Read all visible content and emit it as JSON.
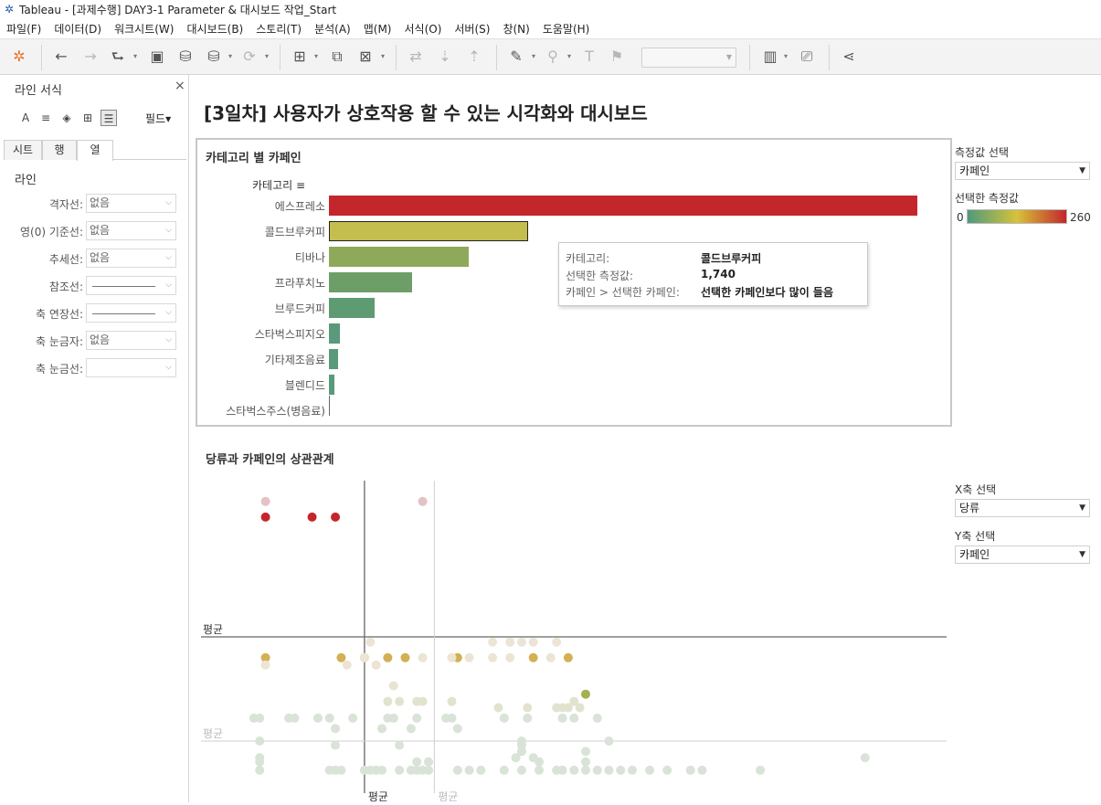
{
  "window": {
    "title": "Tableau - [과제수행] DAY3-1 Parameter & 대시보드 작업_Start"
  },
  "menu": [
    "파일(F)",
    "데이터(D)",
    "워크시트(W)",
    "대시보드(B)",
    "스토리(T)",
    "분석(A)",
    "맵(M)",
    "서식(O)",
    "서버(S)",
    "창(N)",
    "도움말(H)"
  ],
  "toolbar": {
    "buttons": [
      "tableau-logo-icon",
      "undo-icon",
      "redo-icon",
      "replay-icon",
      "save-icon",
      "add-datasource-icon",
      "pause-update-icon",
      "refresh-icon",
      "new-sheet-icon",
      "duplicate-sheet-icon",
      "clear-sheet-icon",
      "swap-icon",
      "sort-asc-icon",
      "sort-desc-icon",
      "highlight-icon",
      "group-icon",
      "label-icon",
      "pin-icon",
      "showme-icon",
      "presentation-icon",
      "share-icon"
    ],
    "fit_value": ""
  },
  "format_pane": {
    "title": "라인 서식",
    "field_dropdown": "필드",
    "tabs": [
      "시트",
      "행",
      "열"
    ],
    "active_tab": "열",
    "section": "라인",
    "rows": [
      {
        "label": "격자선:",
        "value": "없음",
        "kind": "text"
      },
      {
        "label": "영(0) 기준선:",
        "value": "없음",
        "kind": "text"
      },
      {
        "label": "추세선:",
        "value": "없음",
        "kind": "text"
      },
      {
        "label": "참조선:",
        "value": "",
        "kind": "line"
      },
      {
        "label": "축 연장선:",
        "value": "",
        "kind": "line"
      },
      {
        "label": "축 눈금자:",
        "value": "없음",
        "kind": "text"
      },
      {
        "label": "축 눈금선:",
        "value": "",
        "kind": "empty"
      }
    ]
  },
  "dashboard": {
    "title": "[3일차] 사용자가 상호작용 할 수 있는 시각화와 대시보드",
    "bar_sheet": {
      "title": "카테고리 별 카페인",
      "category_header": "카테고리"
    },
    "tooltip": {
      "rows": [
        {
          "key": "카테고리:",
          "value": "콜드브루커피"
        },
        {
          "key": "선택한 측정값:",
          "value": "1,740"
        },
        {
          "key": "카페인 > 선택한 카페인:",
          "value": "선택한 카페인보다 많이 들음"
        }
      ]
    },
    "scatter_sheet": {
      "title": "당류과 카페인의 상관관계",
      "avg_label": "평균"
    }
  },
  "controls": {
    "measure_select": {
      "title": "측정값 선택",
      "value": "카페인"
    },
    "color_legend": {
      "title": "선택한 측정값",
      "min": "0",
      "max": "260",
      "colors": [
        "#4f9a7c",
        "#d6c23a",
        "#c3272b"
      ]
    },
    "x_select": {
      "title": "X축 선택",
      "value": "당류"
    },
    "y_select": {
      "title": "Y축 선택",
      "value": "카페인"
    }
  },
  "chart_data": [
    {
      "type": "bar",
      "title": "카테고리 별 카페인",
      "categories": [
        "에스프레소",
        "콜드브루커피",
        "티바나",
        "프라푸치노",
        "브루드커피",
        "스타벅스피지오",
        "기타제조음료",
        "블렌디드",
        "스타벅스주스(병음료)"
      ],
      "values": [
        5150,
        1740,
        1220,
        730,
        400,
        95,
        80,
        50,
        0
      ],
      "colors": [
        "#c3272b",
        "#c4be4f",
        "#8fa95a",
        "#6e9e68",
        "#5f9b72",
        "#5a997a",
        "#5a997a",
        "#5a997a",
        "#5a997a"
      ],
      "selected": "콜드브루커피"
    },
    {
      "type": "scatter",
      "title": "당류과 카페인의 상관관계",
      "xlabel": "당류",
      "ylabel": "카페인",
      "xlim": [
        0,
        62
      ],
      "ylim": [
        0,
        300
      ],
      "averages": [
        {
          "x": 12,
          "y": 150,
          "label": "평균",
          "active": true
        },
        {
          "x": 18,
          "y": 50,
          "label": "평균",
          "active": false
        }
      ],
      "points": [
        {
          "x": 3.5,
          "y": 280,
          "c": "#e5c2c4"
        },
        {
          "x": 17,
          "y": 280,
          "c": "#e5c2c4"
        },
        {
          "x": 3.5,
          "y": 265,
          "c": "#c3272b"
        },
        {
          "x": 7.5,
          "y": 265,
          "c": "#c3272b"
        },
        {
          "x": 9.5,
          "y": 265,
          "c": "#c3272b"
        },
        {
          "x": 12.5,
          "y": 145,
          "c": "#ece4d4"
        },
        {
          "x": 23,
          "y": 145,
          "c": "#ece4d4"
        },
        {
          "x": 24.5,
          "y": 145,
          "c": "#ece4d4"
        },
        {
          "x": 25.5,
          "y": 145,
          "c": "#ece4d4"
        },
        {
          "x": 26.5,
          "y": 145,
          "c": "#ece4d4"
        },
        {
          "x": 28.5,
          "y": 145,
          "c": "#ece4d4"
        },
        {
          "x": 3.5,
          "y": 130,
          "c": "#d3b055"
        },
        {
          "x": 10,
          "y": 130,
          "c": "#d3b055"
        },
        {
          "x": 12,
          "y": 130,
          "c": "#d3b055"
        },
        {
          "x": 14,
          "y": 130,
          "c": "#d3b055"
        },
        {
          "x": 15.5,
          "y": 130,
          "c": "#d3b055"
        },
        {
          "x": 20,
          "y": 130,
          "c": "#d3b055"
        },
        {
          "x": 26.5,
          "y": 130,
          "c": "#d3b055"
        },
        {
          "x": 29.5,
          "y": 130,
          "c": "#d3b055"
        },
        {
          "x": 12,
          "y": 130,
          "c": "#ece4d4"
        },
        {
          "x": 17,
          "y": 130,
          "c": "#ece4d4"
        },
        {
          "x": 19.5,
          "y": 130,
          "c": "#ece4d4"
        },
        {
          "x": 21,
          "y": 130,
          "c": "#ece4d4"
        },
        {
          "x": 23,
          "y": 130,
          "c": "#ece4d4"
        },
        {
          "x": 24.5,
          "y": 130,
          "c": "#ece4d4"
        },
        {
          "x": 28,
          "y": 130,
          "c": "#ece4d4"
        },
        {
          "x": 3.5,
          "y": 123,
          "c": "#ece4d4"
        },
        {
          "x": 10.5,
          "y": 123,
          "c": "#ece4d4"
        },
        {
          "x": 13,
          "y": 123,
          "c": "#ece4d4"
        },
        {
          "x": 14.5,
          "y": 103,
          "c": "#e7e5cf"
        },
        {
          "x": 31,
          "y": 95,
          "c": "#a7b050"
        },
        {
          "x": 14,
          "y": 88,
          "c": "#e2e3cf"
        },
        {
          "x": 15,
          "y": 88,
          "c": "#e2e3cf"
        },
        {
          "x": 16.5,
          "y": 88,
          "c": "#e2e3cf"
        },
        {
          "x": 17,
          "y": 88,
          "c": "#e2e3cf"
        },
        {
          "x": 19.5,
          "y": 88,
          "c": "#e2e3cf"
        },
        {
          "x": 30,
          "y": 88,
          "c": "#e2e3cf"
        },
        {
          "x": 29,
          "y": 82,
          "c": "#e2e3cf"
        },
        {
          "x": 23.5,
          "y": 82,
          "c": "#e2e3cf"
        },
        {
          "x": 26,
          "y": 82,
          "c": "#e2e3cf"
        },
        {
          "x": 28.5,
          "y": 82,
          "c": "#e2e3cf"
        },
        {
          "x": 29.5,
          "y": 82,
          "c": "#e2e3cf"
        },
        {
          "x": 30.5,
          "y": 82,
          "c": "#e2e3cf"
        },
        {
          "x": 2.5,
          "y": 72,
          "c": "#d9e3d7"
        },
        {
          "x": 3,
          "y": 72,
          "c": "#d9e3d7"
        },
        {
          "x": 5.5,
          "y": 72,
          "c": "#d9e3d7"
        },
        {
          "x": 6,
          "y": 72,
          "c": "#d9e3d7"
        },
        {
          "x": 8,
          "y": 72,
          "c": "#d9e3d7"
        },
        {
          "x": 9,
          "y": 72,
          "c": "#d9e3d7"
        },
        {
          "x": 11,
          "y": 72,
          "c": "#d9e3d7"
        },
        {
          "x": 14,
          "y": 72,
          "c": "#d9e3d7"
        },
        {
          "x": 14.5,
          "y": 72,
          "c": "#d9e3d7"
        },
        {
          "x": 16.5,
          "y": 72,
          "c": "#d9e3d7"
        },
        {
          "x": 19,
          "y": 72,
          "c": "#d9e3d7"
        },
        {
          "x": 19.5,
          "y": 72,
          "c": "#d9e3d7"
        },
        {
          "x": 24,
          "y": 72,
          "c": "#d9e3d7"
        },
        {
          "x": 26,
          "y": 72,
          "c": "#d9e3d7"
        },
        {
          "x": 29,
          "y": 72,
          "c": "#d9e3d7"
        },
        {
          "x": 30,
          "y": 72,
          "c": "#d9e3d7"
        },
        {
          "x": 32,
          "y": 72,
          "c": "#d9e3d7"
        },
        {
          "x": 9.5,
          "y": 62,
          "c": "#d9e3d7"
        },
        {
          "x": 13.5,
          "y": 62,
          "c": "#d9e3d7"
        },
        {
          "x": 16,
          "y": 62,
          "c": "#d9e3d7"
        },
        {
          "x": 20,
          "y": 62,
          "c": "#d9e3d7"
        },
        {
          "x": 3,
          "y": 50,
          "c": "#d9e3d7"
        },
        {
          "x": 25.5,
          "y": 50,
          "c": "#d9e3d7"
        },
        {
          "x": 33,
          "y": 50,
          "c": "#d9e3d7"
        },
        {
          "x": 9.5,
          "y": 46,
          "c": "#d9e3d7"
        },
        {
          "x": 15,
          "y": 46,
          "c": "#d9e3d7"
        },
        {
          "x": 25.5,
          "y": 46,
          "c": "#d9e3d7"
        },
        {
          "x": 25.5,
          "y": 40,
          "c": "#d9e3d7"
        },
        {
          "x": 31,
          "y": 40,
          "c": "#d9e3d7"
        },
        {
          "x": 3,
          "y": 34,
          "c": "#d9e3d7"
        },
        {
          "x": 25,
          "y": 34,
          "c": "#d9e3d7"
        },
        {
          "x": 26.5,
          "y": 34,
          "c": "#d9e3d7"
        },
        {
          "x": 55,
          "y": 34,
          "c": "#d9e3d7"
        },
        {
          "x": 3,
          "y": 30,
          "c": "#d9e3d7"
        },
        {
          "x": 16.5,
          "y": 30,
          "c": "#d9e3d7"
        },
        {
          "x": 17.5,
          "y": 30,
          "c": "#d9e3d7"
        },
        {
          "x": 27,
          "y": 30,
          "c": "#d9e3d7"
        },
        {
          "x": 31,
          "y": 30,
          "c": "#d9e3d7"
        },
        {
          "x": 3,
          "y": 22,
          "c": "#d9e3d7"
        },
        {
          "x": 9,
          "y": 22,
          "c": "#d9e3d7"
        },
        {
          "x": 9.5,
          "y": 22,
          "c": "#d9e3d7"
        },
        {
          "x": 10,
          "y": 22,
          "c": "#d9e3d7"
        },
        {
          "x": 12,
          "y": 22,
          "c": "#d9e3d7"
        },
        {
          "x": 12.5,
          "y": 22,
          "c": "#d9e3d7"
        },
        {
          "x": 13,
          "y": 22,
          "c": "#d9e3d7"
        },
        {
          "x": 13.5,
          "y": 22,
          "c": "#d9e3d7"
        },
        {
          "x": 15,
          "y": 22,
          "c": "#d9e3d7"
        },
        {
          "x": 16,
          "y": 22,
          "c": "#d9e3d7"
        },
        {
          "x": 16.5,
          "y": 22,
          "c": "#d9e3d7"
        },
        {
          "x": 17,
          "y": 22,
          "c": "#d9e3d7"
        },
        {
          "x": 17.5,
          "y": 22,
          "c": "#d9e3d7"
        },
        {
          "x": 20,
          "y": 22,
          "c": "#d9e3d7"
        },
        {
          "x": 21,
          "y": 22,
          "c": "#d9e3d7"
        },
        {
          "x": 22,
          "y": 22,
          "c": "#d9e3d7"
        },
        {
          "x": 24,
          "y": 22,
          "c": "#d9e3d7"
        },
        {
          "x": 25.5,
          "y": 22,
          "c": "#d9e3d7"
        },
        {
          "x": 27,
          "y": 22,
          "c": "#d9e3d7"
        },
        {
          "x": 28.5,
          "y": 22,
          "c": "#d9e3d7"
        },
        {
          "x": 29,
          "y": 22,
          "c": "#d9e3d7"
        },
        {
          "x": 30,
          "y": 22,
          "c": "#d9e3d7"
        },
        {
          "x": 31,
          "y": 22,
          "c": "#d9e3d7"
        },
        {
          "x": 32,
          "y": 22,
          "c": "#d9e3d7"
        },
        {
          "x": 33,
          "y": 22,
          "c": "#d9e3d7"
        },
        {
          "x": 34,
          "y": 22,
          "c": "#d9e3d7"
        },
        {
          "x": 35,
          "y": 22,
          "c": "#d9e3d7"
        },
        {
          "x": 36.5,
          "y": 22,
          "c": "#d9e3d7"
        },
        {
          "x": 38,
          "y": 22,
          "c": "#d9e3d7"
        },
        {
          "x": 40,
          "y": 22,
          "c": "#d9e3d7"
        },
        {
          "x": 41,
          "y": 22,
          "c": "#d9e3d7"
        },
        {
          "x": 46,
          "y": 22,
          "c": "#d9e3d7"
        }
      ]
    }
  ]
}
